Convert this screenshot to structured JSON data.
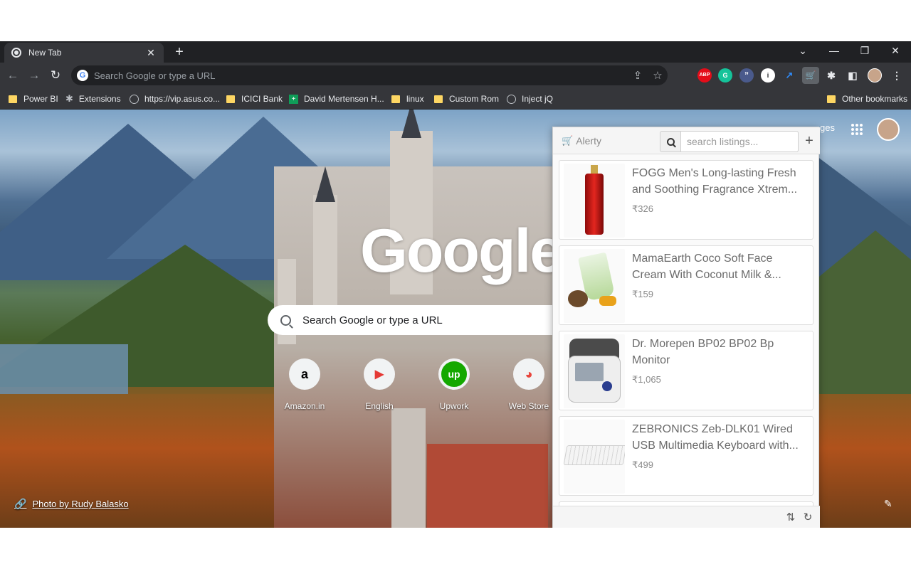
{
  "browser": {
    "tab_title": "New Tab",
    "omnibox_placeholder": "Search Google or type a URL",
    "extensions": [
      {
        "name": "abp",
        "label": "ABP",
        "color": "#e40d1a"
      },
      {
        "name": "grammarly",
        "label": "G",
        "color": "#15c39a"
      },
      {
        "name": "quote",
        "label": "”",
        "color": "#4a5a8c"
      },
      {
        "name": "circle",
        "label": "i",
        "color": "#ffffff"
      },
      {
        "name": "chart",
        "label": "↗",
        "color": "#2f6fd6"
      },
      {
        "name": "alerty",
        "label": "🛒",
        "color": "#f4b400"
      }
    ]
  },
  "bookmarks": [
    {
      "label": "Power BI",
      "icon": "folder-icon"
    },
    {
      "label": "Extensions",
      "icon": "puzzle-icon"
    },
    {
      "label": "https://vip.asus.co...",
      "icon": "globe-icon"
    },
    {
      "label": "ICICI Bank",
      "icon": "folder-icon"
    },
    {
      "label": "David Mertensen H...",
      "icon": "green-plus-icon"
    },
    {
      "label": "linux",
      "icon": "folder-icon"
    },
    {
      "label": "Custom Rom",
      "icon": "folder-icon"
    },
    {
      "label": "Inject jQ",
      "icon": "globe-icon"
    },
    {
      "label": "Other bookmarks",
      "icon": "folder-icon"
    }
  ],
  "ntp": {
    "logo": "Google",
    "search_placeholder": "Search Google or type a URL",
    "images_label": "ges",
    "shortcuts": [
      {
        "label": "Amazon.in",
        "glyph": "a"
      },
      {
        "label": "English",
        "glyph": "▶"
      },
      {
        "label": "Upwork",
        "glyph": "up"
      },
      {
        "label": "Web Store",
        "glyph": "◕"
      }
    ],
    "photo_credit": "Photo by Rudy Balasko"
  },
  "popup": {
    "brand": "Alerty",
    "search_placeholder": "search listings...",
    "listings": [
      {
        "title": "FOGG Men's Long-lasting Fresh and Soothing Fragrance Xtrem...",
        "price": "₹326"
      },
      {
        "title": "MamaEarth Coco Soft Face Cream With Coconut Milk &...",
        "price": "₹159"
      },
      {
        "title": "Dr. Morepen BP02 BP02 Bp Monitor",
        "price": "₹1,065"
      },
      {
        "title": "ZEBRONICS Zeb-DLK01 Wired USB Multimedia Keyboard with...",
        "price": "₹499"
      }
    ]
  }
}
